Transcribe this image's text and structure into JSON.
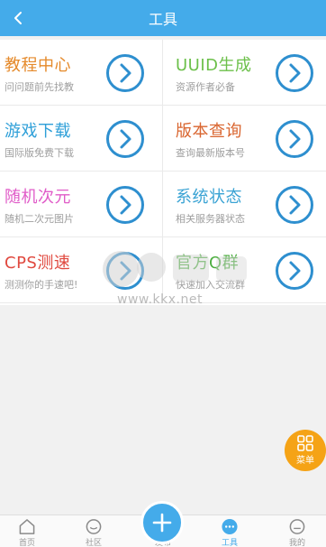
{
  "header": {
    "title": "工具"
  },
  "tools": [
    {
      "title": "教程中心",
      "subtitle": "问问题前先找教",
      "color": "#e58a2b"
    },
    {
      "title": "UUID生成",
      "subtitle": "资源作者必备",
      "color": "#6cc04a"
    },
    {
      "title": "游戏下载",
      "subtitle": "国际版免费下载",
      "color": "#2e9fd8"
    },
    {
      "title": "版本查询",
      "subtitle": "查询最新版本号",
      "color": "#d9652f"
    },
    {
      "title": "随机次元",
      "subtitle": "随机二次元图片",
      "color": "#e05cc8"
    },
    {
      "title": "系统状态",
      "subtitle": "相关服务器状态",
      "color": "#3aa3d4"
    },
    {
      "title": "CPS测速",
      "subtitle": "测测你的手速吧!",
      "color": "#e0493f"
    },
    {
      "title": "官方Q群",
      "subtitle": "快速加入交流群",
      "color": "#4cae3f"
    }
  ],
  "watermark": {
    "text": "www.kkx.net"
  },
  "fab_menu": {
    "label": "菜单"
  },
  "tabbar": {
    "items": [
      {
        "label": "首页",
        "icon": "home-icon"
      },
      {
        "label": "社区",
        "icon": "chat-icon"
      },
      {
        "label": "发布",
        "icon": "add-icon"
      },
      {
        "label": "工具",
        "icon": "tools-icon",
        "active": true
      },
      {
        "label": "我的",
        "icon": "profile-icon"
      }
    ]
  },
  "colors": {
    "accent": "#44abea",
    "menu": "#f5a316"
  }
}
